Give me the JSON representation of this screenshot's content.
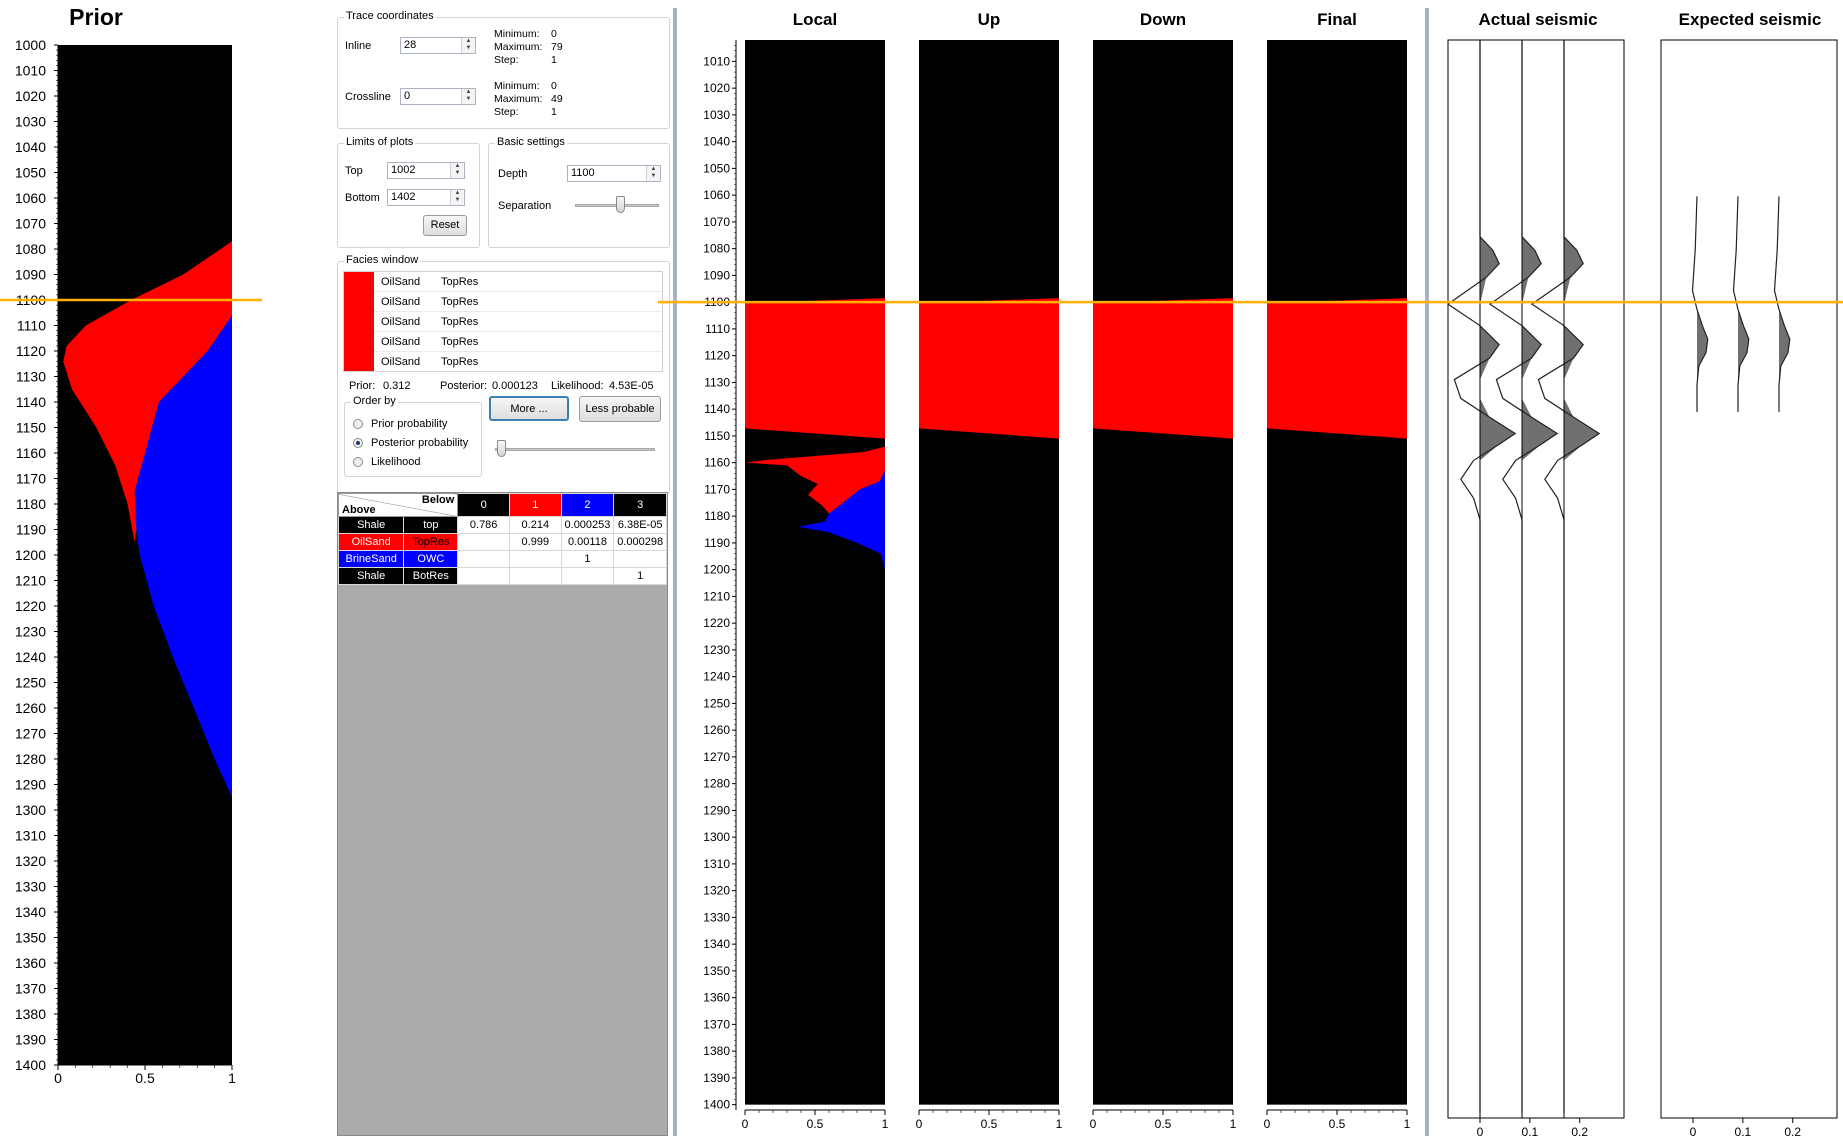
{
  "prior": {
    "title": "Prior",
    "depth_ticks": [
      "1000",
      "1010",
      "1020",
      "1030",
      "1040",
      "1050",
      "1060",
      "1070",
      "1080",
      "1090",
      "1100",
      "1110",
      "1120",
      "1130",
      "1140",
      "1150",
      "1160",
      "1170",
      "1180",
      "1190",
      "1200",
      "1210",
      "1220",
      "1230",
      "1240",
      "1250",
      "1260",
      "1270",
      "1280",
      "1290",
      "1300",
      "1310",
      "1320",
      "1330",
      "1340",
      "1350",
      "1360",
      "1370",
      "1380",
      "1390",
      "1400"
    ],
    "x_ticks": [
      "0",
      "0.5",
      "1"
    ]
  },
  "trace_coordinates": {
    "label": "Trace coordinates",
    "inline_label": "Inline",
    "inline_value": "28",
    "inline_min": "Minimum:",
    "inline_min_val": "0",
    "inline_max": "Maximum:",
    "inline_max_val": "79",
    "inline_step": "Step:",
    "inline_step_val": "1",
    "crossline_label": "Crossline",
    "crossline_value": "0",
    "crossline_min": "Minimum:",
    "crossline_min_val": "0",
    "crossline_max": "Maximum:",
    "crossline_max_val": "49",
    "crossline_step": "Step:",
    "crossline_step_val": "1"
  },
  "limits": {
    "label": "Limits of plots",
    "top_label": "Top",
    "top_value": "1002",
    "bottom_label": "Bottom",
    "bottom_value": "1402",
    "reset_label": "Reset"
  },
  "basic_settings": {
    "label": "Basic settings",
    "depth_label": "Depth",
    "depth_value": "1100",
    "separation_label": "Separation",
    "separation_level": 0.55
  },
  "facies_window": {
    "label": "Facies window",
    "rows": [
      {
        "facies": "OilSand",
        "surface": "TopRes",
        "color": "#ff0000"
      },
      {
        "facies": "OilSand",
        "surface": "TopRes",
        "color": "#ff0000"
      },
      {
        "facies": "OilSand",
        "surface": "TopRes",
        "color": "#ff0000"
      },
      {
        "facies": "OilSand",
        "surface": "TopRes",
        "color": "#ff0000"
      },
      {
        "facies": "OilSand",
        "surface": "TopRes",
        "color": "#ff0000"
      }
    ],
    "prior_label": "Prior:",
    "prior_value": "0.312",
    "posterior_label": "Posterior:",
    "posterior_value": "0.000123",
    "likelihood_label": "Likelihood:",
    "likelihood_value": "4.53E-05",
    "order_by_label": "Order by",
    "order_options": [
      "Prior probability",
      "Posterior probability",
      "Likelihood"
    ],
    "selected_order": "Posterior probability",
    "more_label": "More ...",
    "less_label": "Less probable",
    "slider_level": 0.0
  },
  "transition_table": {
    "corner_above": "Above",
    "corner_below": "Below",
    "col_headers": [
      {
        "text": "0",
        "bg": "#000000",
        "fg": "#ffffff"
      },
      {
        "text": "1",
        "bg": "#ff0000",
        "fg": "#ffffff"
      },
      {
        "text": "2",
        "bg": "#0000ff",
        "fg": "#ffffff"
      },
      {
        "text": "3",
        "bg": "#000000",
        "fg": "#ffffff"
      }
    ],
    "rows": [
      {
        "facies": "Shale",
        "surface": "top",
        "bg": "#000000",
        "fg": "#ffffff",
        "fg2": "#ffffff",
        "cells": [
          "0.786",
          "0.214",
          "0.000253",
          "6.38E-05"
        ]
      },
      {
        "facies": "OilSand",
        "surface": "TopRes",
        "bg": "#ff0000",
        "fg": "#ffffff",
        "fg2": "#000000",
        "cells": [
          "",
          "0.999",
          "0.00118",
          "0.000298"
        ]
      },
      {
        "facies": "BrineSand",
        "surface": "OWC",
        "bg": "#0000ff",
        "fg": "#ffffff",
        "fg2": "#ffffff",
        "cells": [
          "",
          "",
          "1",
          ""
        ]
      },
      {
        "facies": "Shale",
        "surface": "BotRes",
        "bg": "#000000",
        "fg": "#ffffff",
        "fg2": "#ffffff",
        "cells": [
          "",
          "",
          "",
          "1"
        ]
      }
    ]
  },
  "facies_columns": {
    "titles": [
      "Local",
      "Up",
      "Down",
      "Final"
    ],
    "depth_ticks": [
      "1010",
      "1020",
      "1030",
      "1040",
      "1050",
      "1060",
      "1070",
      "1080",
      "1090",
      "1100",
      "1110",
      "1120",
      "1130",
      "1140",
      "1150",
      "1160",
      "1170",
      "1180",
      "1190",
      "1200",
      "1210",
      "1220",
      "1230",
      "1240",
      "1250",
      "1260",
      "1270",
      "1280",
      "1290",
      "1300",
      "1310",
      "1320",
      "1330",
      "1340",
      "1350",
      "1360",
      "1370",
      "1380",
      "1390",
      "1400"
    ],
    "x_ticks": [
      "0",
      "0.5",
      "1"
    ]
  },
  "seismic": {
    "actual_title": "Actual seismic",
    "expected_title": "Expected seismic",
    "x_ticks": [
      "0",
      "0.1",
      "0.2"
    ]
  },
  "colors": {
    "shale": "#000000",
    "oilsand": "#ff0000",
    "brinesand": "#0000ff",
    "depth_marker": "#ffb000",
    "divider": "#aab0c8",
    "wiggle_fill": "#707070"
  },
  "depth_marker_value": 1100
}
